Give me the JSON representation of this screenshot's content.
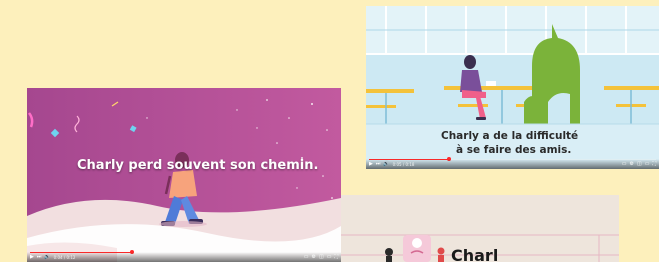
{
  "colors": {
    "page_background": "#fdf0bc",
    "player_progress": "#ff2a2a",
    "pink_scene": "#b74d97",
    "classroom_sky": "#cde9f3",
    "third_scene": "#eee5dc"
  },
  "videos": [
    {
      "caption": "Charly perd souvent son chemin.",
      "progress": 0.33,
      "time": "0:04 / 0:12"
    },
    {
      "caption_line1": "Charly a de la difficulté",
      "caption_line2": "à se faire des amis.",
      "progress": 0.28,
      "time": "0:05 / 0:18"
    },
    {
      "title_fragment": "Charl"
    }
  ],
  "icons": {
    "play": "▶",
    "next": "⏭",
    "volume": "🔊",
    "settings": "⚙",
    "subtitles": "▭",
    "miniplayer": "◫",
    "theater": "▭",
    "fullscreen": "⛶"
  }
}
